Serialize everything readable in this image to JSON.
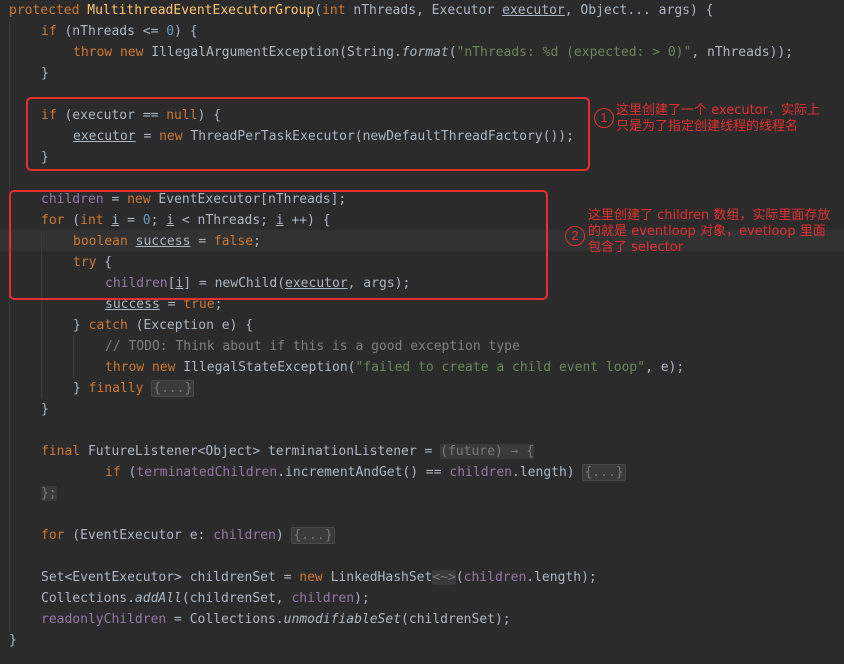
{
  "code": {
    "l1": {
      "kw": "protected",
      "method": "MultithreadEventExecutorGroup",
      "p1": "(",
      "kw2": "int",
      "p2": " nThreads, Executor ",
      "executor": "executor",
      "p3": ", Object... args) {"
    },
    "l2": {
      "kw": "if",
      "p1": " (nThreads <= ",
      "num": "0",
      "p2": ") {"
    },
    "l3": {
      "kw": "throw new",
      "p1": " IllegalArgumentException(String.",
      "fmt": "format",
      "p2": "(",
      "str": "\"nThreads: %d (expected: > 0)\"",
      "p3": ", nThreads));"
    },
    "l4": {
      "p1": "}"
    },
    "l5": {
      "kw": "if",
      "p1": " (executor == ",
      "kw2": "null",
      "p2": ") {"
    },
    "l6": {
      "executor": "executor",
      "p1": " = ",
      "kw": "new",
      "p2": " ThreadPerTaskExecutor(newDefaultThreadFactory());"
    },
    "l7": {
      "p1": "}"
    },
    "l8": {
      "field": "children",
      "p1": " = ",
      "kw": "new",
      "p2": " EventExecutor[nThreads];"
    },
    "l9": {
      "kw": "for",
      "p1": " (",
      "kw2": "int",
      "sp": " ",
      "i1": "i",
      "p2": " = ",
      "num": "0",
      "p3": "; ",
      "i2": "i",
      "p4": " < nThreads; ",
      "i3": "i",
      "p5": " ++) {"
    },
    "l10": {
      "kw": "boolean",
      "sp": " ",
      "success": "success",
      "p1": " = ",
      "kw2": "false",
      "p2": ";"
    },
    "l11": {
      "kw": "try",
      "p1": " {"
    },
    "l12": {
      "field": "children",
      "p1": "[",
      "i": "i",
      "p2": "] = newChild(",
      "executor": "executor",
      "p3": ", args);"
    },
    "l13": {
      "success": "success",
      "p1": " = ",
      "kw": "true",
      "p2": ";"
    },
    "l14": {
      "p1": "} ",
      "kw": "catch",
      "p2": " (Exception e) {"
    },
    "l15": {
      "comment": "// TODO: Think about if this is a good exception type"
    },
    "l16": {
      "kw": "throw new",
      "p1": " IllegalStateException(",
      "str": "\"failed to create a child event loop\"",
      "p2": ", e);"
    },
    "l17": {
      "p1": "} ",
      "kw": "finally",
      "sp": " ",
      "fold": "{...}"
    },
    "l18": {
      "p1": "}"
    },
    "l19": {
      "kw": "final",
      "p1": " FutureListener<Object> terminationListener = ",
      "lambda": "(future) → {"
    },
    "l20": {
      "kw": "if",
      "p1": " (",
      "field": "terminatedChildren",
      "p2": ".incrementAndGet() == ",
      "field2": "children",
      "p3": ".length) ",
      "fold": "{...}"
    },
    "l21": {
      "p1": "};"
    },
    "l22": {
      "kw": "for",
      "p1": " (EventExecutor e: ",
      "field": "children",
      "p2": ") ",
      "fold": "{...}"
    },
    "l23": {
      "p1": "Set<EventExecutor> childrenSet = ",
      "kw": "new",
      "p2": " LinkedHashSet",
      "diamond": "<~>",
      "p3": "(",
      "field": "children",
      "p4": ".length);"
    },
    "l24": {
      "p1": "Collections.",
      "m": "addAll",
      "p2": "(childrenSet, ",
      "field": "children",
      "p3": ");"
    },
    "l25": {
      "field": "readonlyChildren",
      "p1": " = Collections.",
      "m": "unmodifiableSet",
      "p2": "(childrenSet);"
    },
    "l26": {
      "p1": "}"
    }
  },
  "annotations": [
    {
      "number": "1",
      "text": "这里创建了一个 executor，实际上\n只是为了指定创建线程的线程名"
    },
    {
      "number": "2",
      "text": "这里创建了 children 数组，实际里面存放\n的就是 eventloop 对象，evetloop 里面\n包含了 selector"
    }
  ],
  "colors": {
    "background": "#2b2b2b",
    "keyword": "#cc7832",
    "method": "#ffc66d",
    "number": "#6897bb",
    "string": "#6a8759",
    "field": "#9876aa",
    "annotation": "#e23030"
  }
}
